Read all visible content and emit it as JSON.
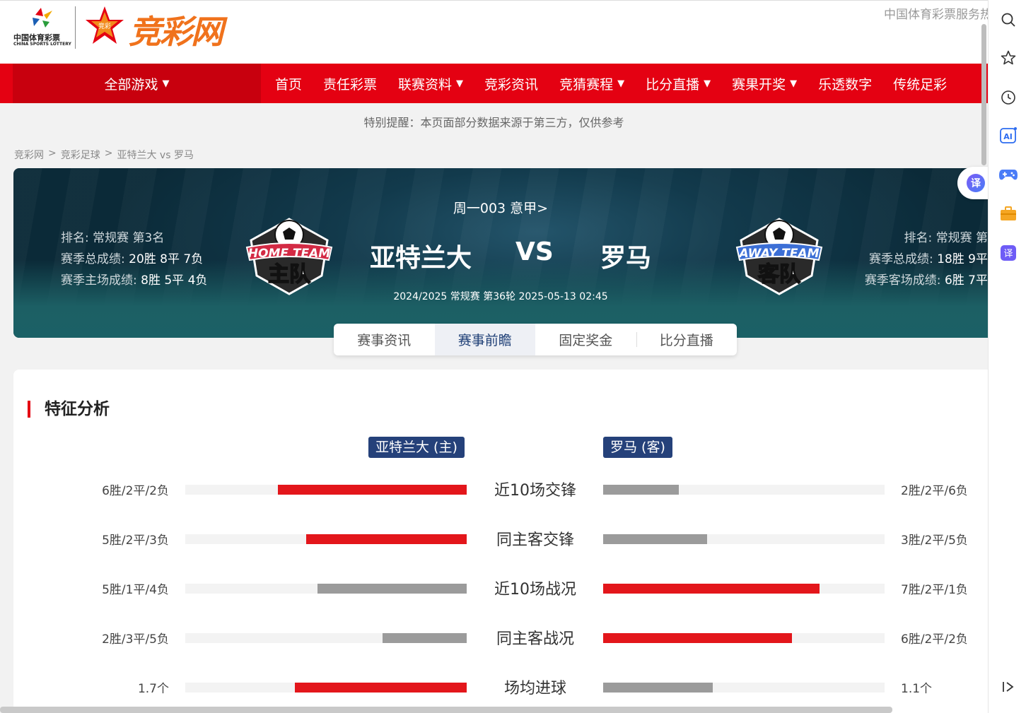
{
  "header": {
    "logo_cn": "中国体育彩票",
    "logo_en": "CHINA SPORTS LOTTERY",
    "brand_badge": "竞彩",
    "brand": "竞彩网",
    "service_text": "中国体育彩票服务热"
  },
  "nav": {
    "all_games": "全部游戏",
    "items": [
      {
        "label": "首页",
        "has_caret": false
      },
      {
        "label": "责任彩票",
        "has_caret": false
      },
      {
        "label": "联赛资料",
        "has_caret": true
      },
      {
        "label": "竞彩资讯",
        "has_caret": false
      },
      {
        "label": "竞猜赛程",
        "has_caret": true
      },
      {
        "label": "比分直播",
        "has_caret": true
      },
      {
        "label": "赛果开奖",
        "has_caret": true
      },
      {
        "label": "乐透数字",
        "has_caret": false
      },
      {
        "label": "传统足彩",
        "has_caret": false
      }
    ],
    "caret": "▼"
  },
  "notice": "特别提醒：本页面部分数据来源于第三方，仅供参考",
  "breadcrumb": {
    "items": [
      "竞彩网",
      "竞彩足球",
      "亚特兰大 vs 罗马"
    ],
    "separator": ">"
  },
  "match": {
    "league_line": "周一003 意甲>",
    "home": {
      "name": "亚特兰大",
      "badge_top": "HOME TEAM",
      "badge_main": "主队",
      "rank": "排名: 常规赛 第3名",
      "season_label": "赛季总成绩: ",
      "season_value": "20胜 8平 7负",
      "venue_label": "赛季主场成绩: ",
      "venue_value": "8胜 5平 4负"
    },
    "away": {
      "name": "罗马",
      "badge_top": "AWAY TEAM",
      "badge_main": "客队",
      "rank": "排名: 常规赛 第",
      "season_label": "赛季总成绩: ",
      "season_value": "18胜 9平",
      "venue_label": "赛季客场成绩: ",
      "venue_value": "6胜 7平"
    },
    "vs": "VS",
    "meta": "2024/2025 常规赛 第36轮 2025-05-13 02:45"
  },
  "tabs": {
    "items": [
      "赛事资讯",
      "赛事前瞻",
      "固定奖金",
      "比分直播"
    ],
    "active_index": 1
  },
  "analysis": {
    "title": "特征分析",
    "home_tag": "亚特兰大 (主)",
    "away_tag": "罗马 (客)",
    "rows": [
      {
        "label": "近10场交锋",
        "home_value": "6胜/2平/2负",
        "away_value": "2胜/2平/6负",
        "home_ratio": 0.67,
        "away_ratio": 0.27,
        "home_color": "#e3161b",
        "away_color": "#9b9b9b"
      },
      {
        "label": "同主客交锋",
        "home_value": "5胜/2平/3负",
        "away_value": "3胜/2平/5负",
        "home_ratio": 0.57,
        "away_ratio": 0.37,
        "home_color": "#e3161b",
        "away_color": "#9b9b9b"
      },
      {
        "label": "近10场战况",
        "home_value": "5胜/1平/4负",
        "away_value": "7胜/2平/1负",
        "home_ratio": 0.53,
        "away_ratio": 0.77,
        "home_color": "#9b9b9b",
        "away_color": "#e3161b"
      },
      {
        "label": "同主客战况",
        "home_value": "2胜/3平/5负",
        "away_value": "6胜/2平/2负",
        "home_ratio": 0.3,
        "away_ratio": 0.67,
        "home_color": "#9b9b9b",
        "away_color": "#e3161b"
      },
      {
        "label": "场均进球",
        "home_value": "1.7个",
        "away_value": "1.1个",
        "home_ratio": 0.61,
        "away_ratio": 0.39,
        "home_color": "#e3161b",
        "away_color": "#9b9b9b"
      }
    ]
  },
  "rail": {
    "icons": [
      "search-icon",
      "star-icon",
      "history-icon",
      "ai-icon",
      "game-icon",
      "briefcase-icon",
      "translate-icon",
      "collapse-icon"
    ],
    "translate_float": "译",
    "ai_label": "AI",
    "translate_label": "译"
  }
}
